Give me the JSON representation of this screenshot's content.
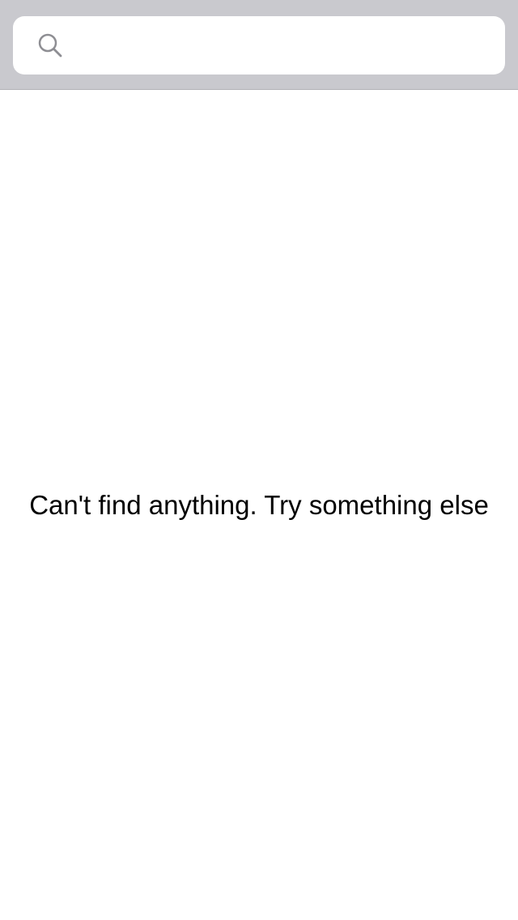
{
  "search": {
    "value": "",
    "placeholder": "",
    "icon": "search-icon"
  },
  "results": {
    "empty_message": "Can't find anything. Try something else"
  },
  "colors": {
    "search_bar_background": "#c9c9ce",
    "field_background": "#ffffff",
    "icon_color": "#8e8e93",
    "text_color": "#000000"
  }
}
